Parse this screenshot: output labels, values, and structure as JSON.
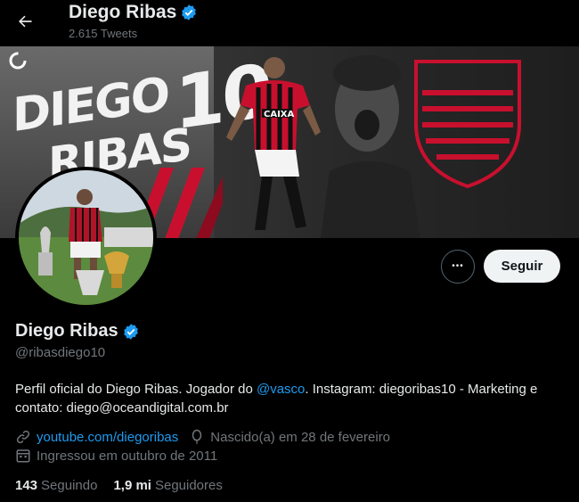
{
  "header": {
    "title": "Diego Ribas",
    "tweet_count": "2.615 Tweets"
  },
  "banner": {
    "text_line1": "DIEGO",
    "text_line2": "RIBAS",
    "text_number": "10",
    "shirt_text": "CAIXA"
  },
  "actions": {
    "more_label": "•••",
    "follow_label": "Seguir"
  },
  "profile": {
    "name": "Diego Ribas",
    "handle": "@ribasdiego10",
    "bio_before": "Perfil oficial do Diego Ribas. Jogador do ",
    "bio_mention": "@vasco",
    "bio_after": ". Instagram: diegoribas10 - Marketing e contato: diego@oceandigital.com.br",
    "website": "youtube.com/diegoribas",
    "birthday": "Nascido(a) em 28 de fevereiro",
    "joined": "Ingressou em outubro de 2011"
  },
  "stats": {
    "following_count": "143",
    "following_label": "Seguindo",
    "followers_count": "1,9 mi",
    "followers_label": "Seguidores"
  },
  "colors": {
    "accent": "#1d9bf0",
    "flamengo_red": "#c8102e"
  }
}
